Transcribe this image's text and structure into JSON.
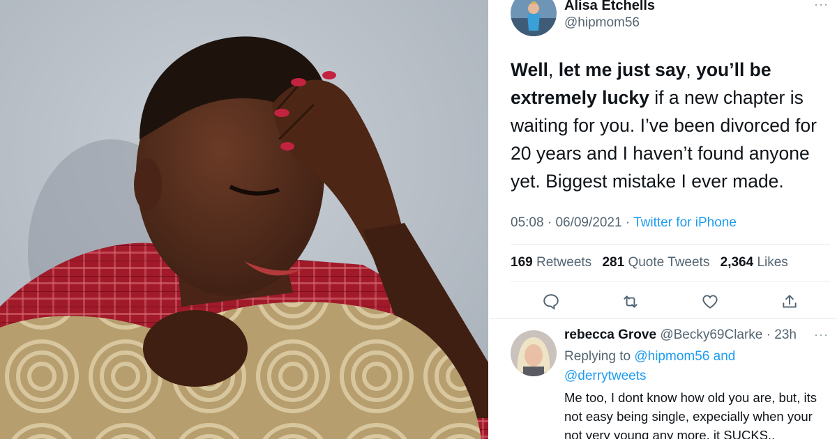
{
  "tweet": {
    "author_name": "Alisa Etchells",
    "author_handle": "@hipmom56",
    "more_icon": "more-dots-icon",
    "text_parts": [
      {
        "t": "Well",
        "b": true
      },
      {
        "t": ", ",
        "b": false
      },
      {
        "t": "let me just say",
        "b": true
      },
      {
        "t": ", ",
        "b": false
      },
      {
        "t": "you’ll be extremely lucky",
        "b": true
      },
      {
        "t": " if a new chapter is waiting for you. I’ve been divorced for 20 years and I haven’t found anyone yet. Biggest mistake I ever made.",
        "b": false
      }
    ],
    "time": "05:08",
    "date": "06/09/2021",
    "source": "Twitter for iPhone",
    "stats": {
      "retweets_count": "169",
      "retweets_label": "Retweets",
      "quotes_count": "281",
      "quotes_label": "Quote Tweets",
      "likes_count": "2,364",
      "likes_label": "Likes"
    },
    "actions": [
      "reply-icon",
      "retweet-icon",
      "like-icon",
      "share-icon"
    ]
  },
  "reply": {
    "author_name": "rebecca Grove",
    "author_handle": "@Becky69Clarke",
    "age": "23h",
    "replying_prefix": "Replying to",
    "mention_1": "@hipmom56",
    "and_word": "and",
    "mention_2": "@derrytweets",
    "text": "Me too, I dont know how old you are, but, its not easy being single,  expecially when your not very young any more, it SUCKS.."
  },
  "colors": {
    "link_blue": "#1d9bf0",
    "muted_gray": "#536471",
    "text_dark": "#0f1419",
    "like_pink": "#e0245e"
  }
}
